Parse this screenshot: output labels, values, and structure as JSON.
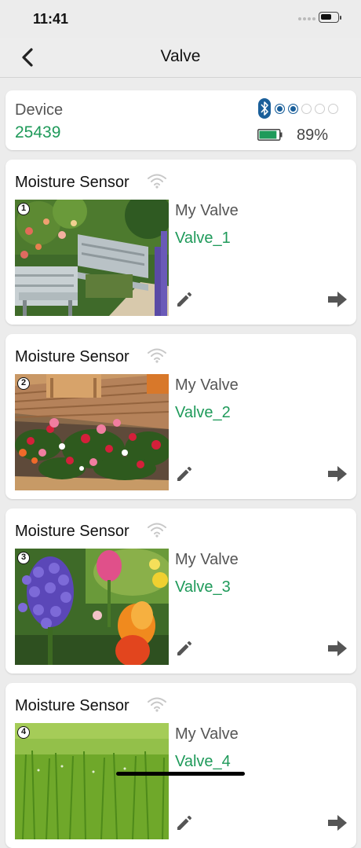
{
  "status_bar": {
    "time": "11:41"
  },
  "nav": {
    "title": "Valve"
  },
  "device": {
    "label": "Device",
    "id": "25439",
    "signal_level": 2,
    "signal_max": 5,
    "battery_percent": "89%",
    "battery_level": 0.89
  },
  "valves": [
    {
      "number": "1",
      "sensor_title": "Moisture Sensor",
      "label": "My Valve",
      "name": "Valve_1",
      "photo": "garden-bench"
    },
    {
      "number": "2",
      "sensor_title": "Moisture Sensor",
      "label": "My Valve",
      "name": "Valve_2",
      "photo": "flower-bed-deck"
    },
    {
      "number": "3",
      "sensor_title": "Moisture Sensor",
      "label": "My Valve",
      "name": "Valve_3",
      "photo": "hyacinth-tulips"
    },
    {
      "number": "4",
      "sensor_title": "Moisture Sensor",
      "label": "My Valve",
      "name": "Valve_4",
      "photo": "grass"
    }
  ],
  "colors": {
    "accent": "#1f9a5a",
    "bluetooth": "#1a5f9a",
    "battery": "#1f9a5a"
  },
  "icons": [
    "back-chevron-icon",
    "bluetooth-icon",
    "battery-icon",
    "wifi-icon",
    "pencil-icon",
    "arrow-right-icon"
  ]
}
